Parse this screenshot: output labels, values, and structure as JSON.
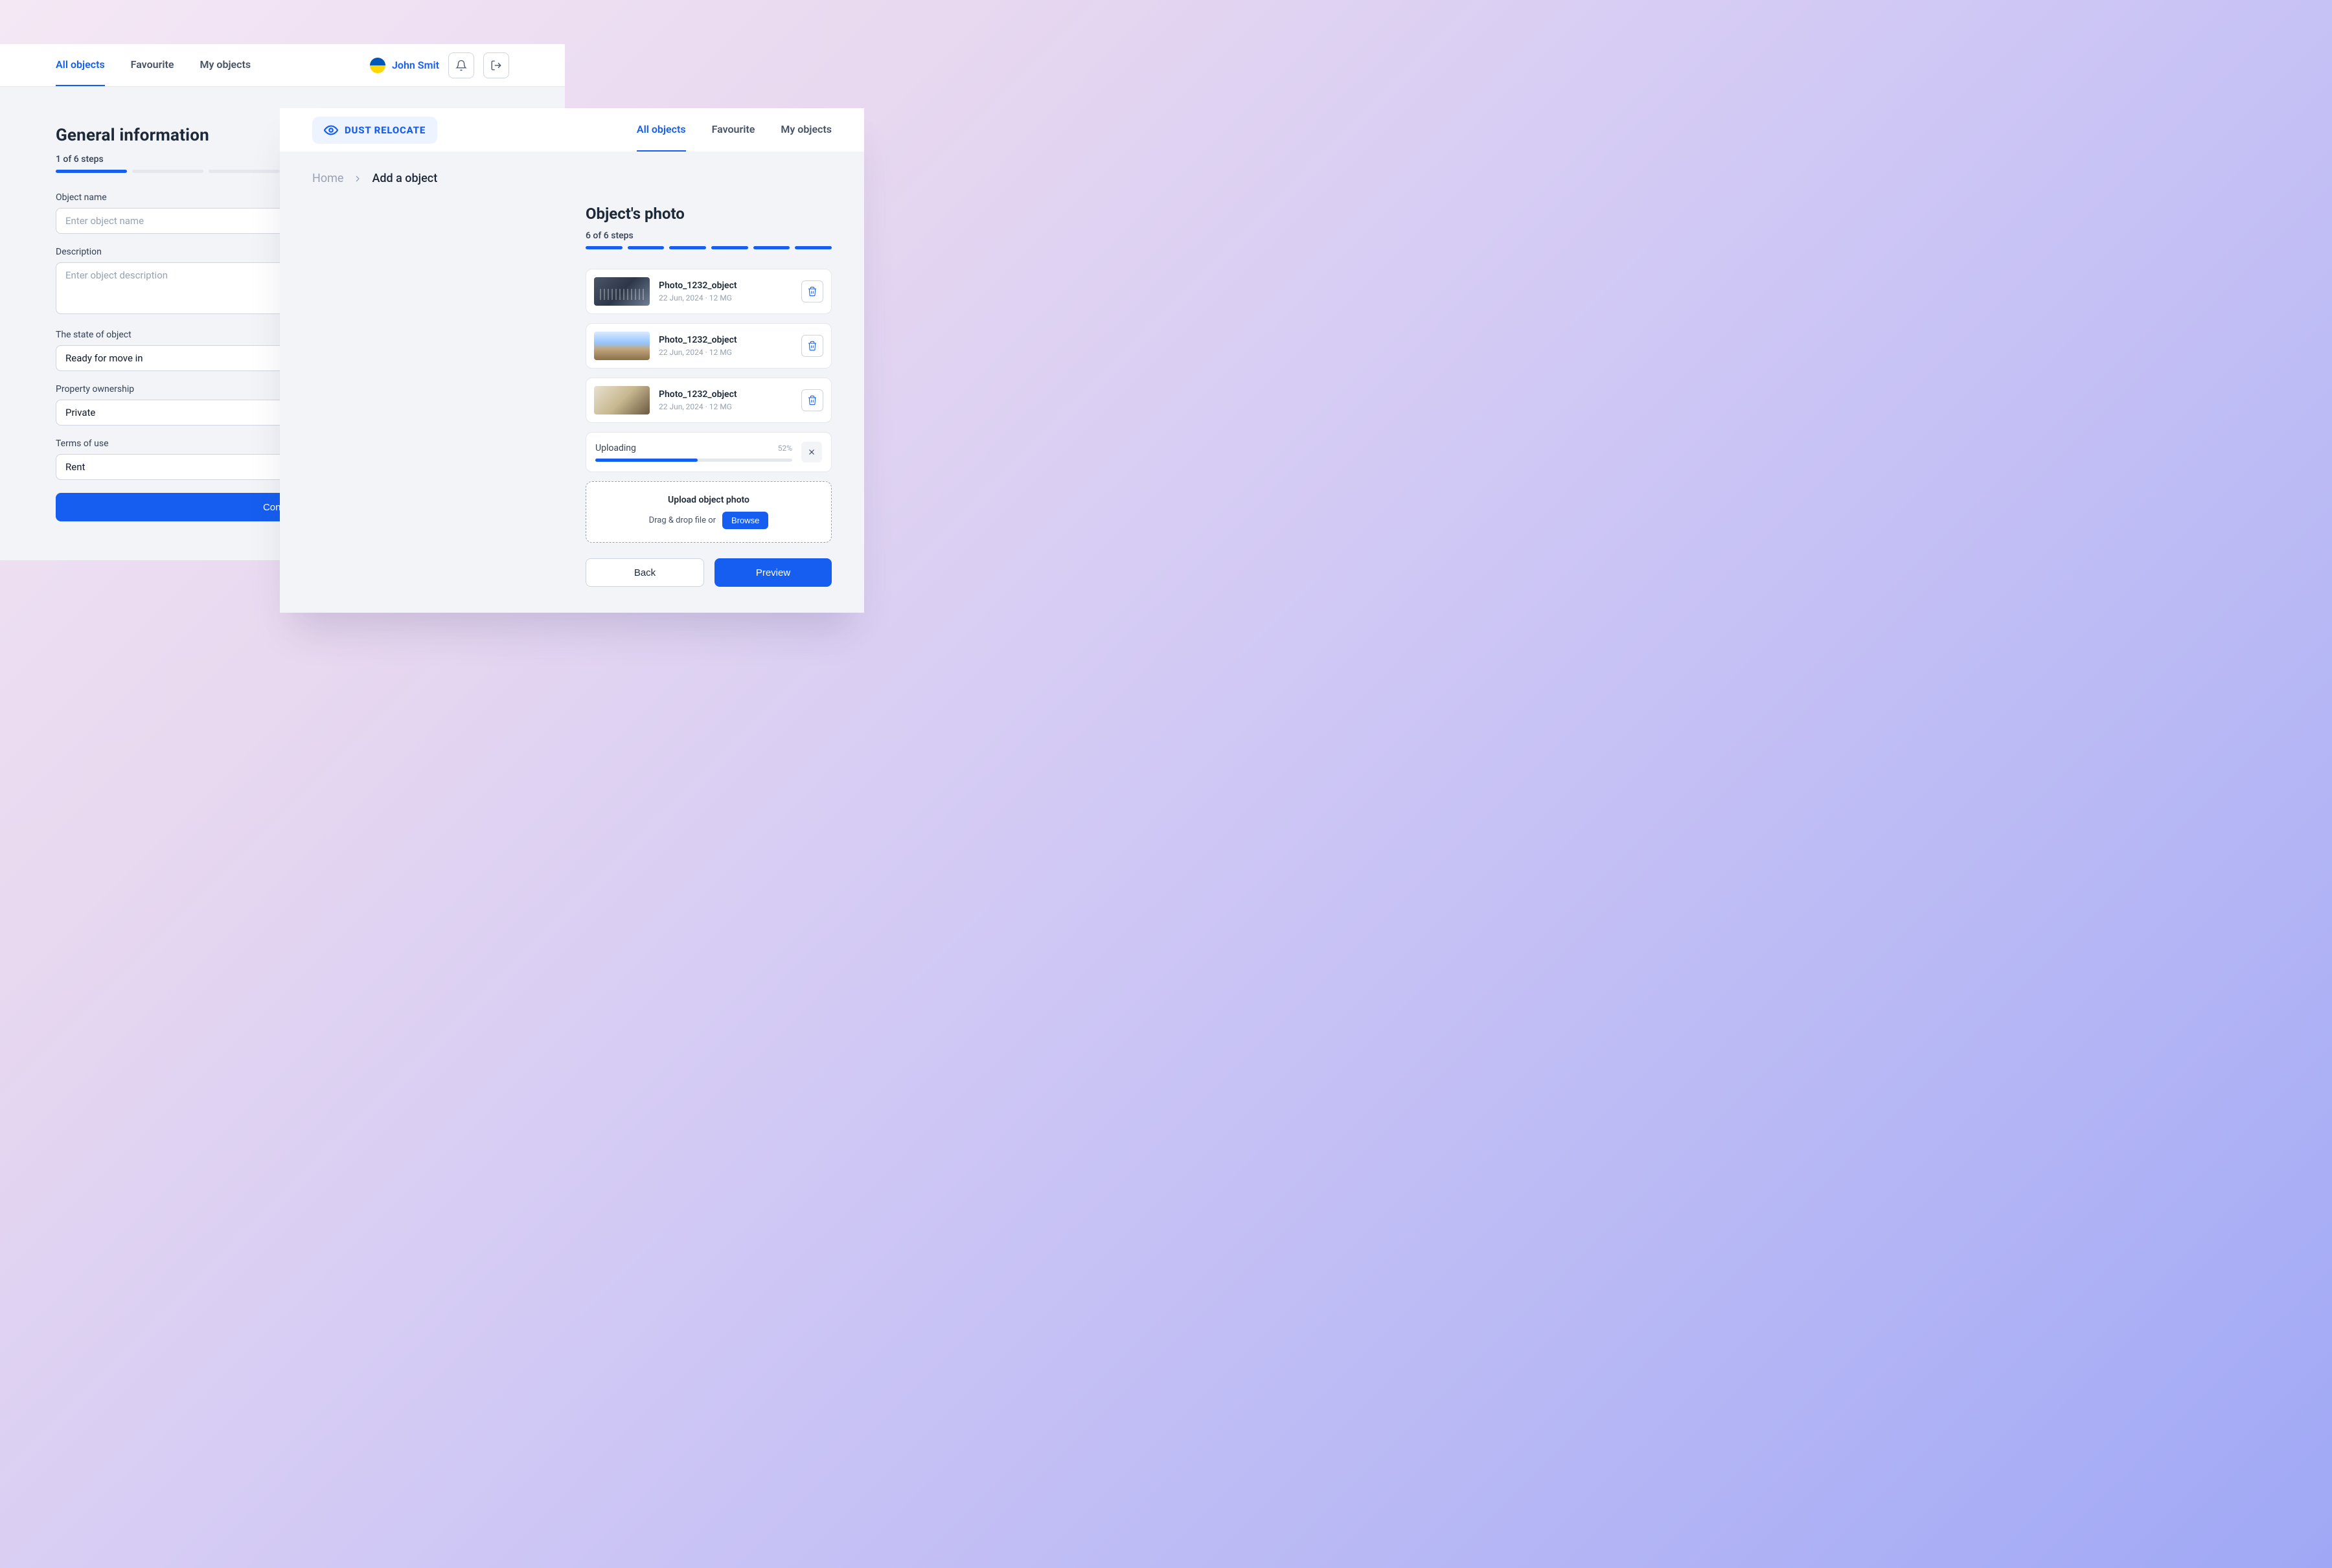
{
  "colors": {
    "primary": "#155eef"
  },
  "left": {
    "nav": {
      "tabs": [
        "All objects",
        "Favourite",
        "My objects"
      ],
      "activeIndex": 0,
      "user": "John Smit"
    },
    "form": {
      "title": "General information",
      "step_label": "1 of 6 steps",
      "steps_total": 6,
      "steps_filled": 1,
      "fields": {
        "name_label": "Object name",
        "name_placeholder": "Enter object name",
        "desc_label": "Description",
        "desc_placeholder": "Enter object description",
        "state_label": "The state of object",
        "state_value": "Ready for move in",
        "ownership_label": "Property ownership",
        "ownership_value": "Private",
        "terms_label": "Terms of use",
        "terms_value": "Rent"
      },
      "continue": "Continue"
    }
  },
  "right": {
    "nav": {
      "logo": "DUST RELOCATE",
      "tabs": [
        "All objects",
        "Favourite",
        "My objects"
      ],
      "activeIndex": 0
    },
    "breadcrumb": {
      "home": "Home",
      "current": "Add a object"
    },
    "photos": {
      "title": "Object's photo",
      "step_label": "6 of 6 steps",
      "steps_total": 6,
      "steps_filled": 6,
      "items": [
        {
          "name": "Photo_1232_object",
          "date": "22 Jun, 2024",
          "size": "12 MG"
        },
        {
          "name": "Photo_1232_object",
          "date": "22 Jun, 2024",
          "size": "12 MG"
        },
        {
          "name": "Photo_1232_object",
          "date": "22 Jun, 2024",
          "size": "12 MG"
        }
      ],
      "upload": {
        "label": "Uploading",
        "percent": 52,
        "percent_text": "52%"
      },
      "dropzone": {
        "title": "Upload object photo",
        "hint": "Drag & drop file or",
        "browse": "Browse"
      },
      "back": "Back",
      "preview": "Preview"
    }
  }
}
